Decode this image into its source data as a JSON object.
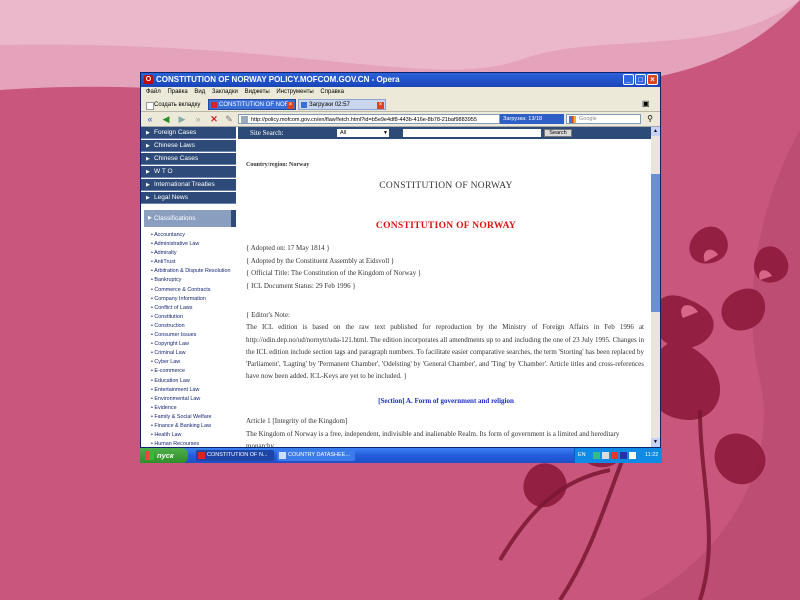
{
  "window": {
    "title": "CONSTITUTION OF NORWAY POLICY.MOFCOM.GOV.CN - Opera",
    "menu": [
      "Файл",
      "Правка",
      "Вид",
      "Закладки",
      "Виджеты",
      "Инструменты",
      "Справка"
    ]
  },
  "tabs": [
    {
      "label": "Создать вкладку",
      "active": false
    },
    {
      "label": "CONSTITUTION OF NOR...",
      "active": true
    },
    {
      "label": "Загрузки 02:57",
      "active": false
    }
  ],
  "address": {
    "url": "http://policy.mofcom.gov.cn/en/flaw!fetch.html?id=b5e9e4df8-443b-416e-8b78-21baf9883955",
    "progress": "Загрузка: 13/18",
    "search_placeholder": "Google"
  },
  "sidebar": {
    "nav": [
      "Foreign Cases",
      "Chinese Laws",
      "Chinese Cases",
      "W T O",
      "International Treaties",
      "Legal News"
    ],
    "classifications_title": "Classifications",
    "classifications": [
      "Accountancy",
      "Administrative Law",
      "Admiralty",
      "AntiTrust",
      "Arbitration & Dispute Resolution",
      "Bankruptcy",
      "Commerce & Contracts",
      "Company Information",
      "Conflict of Laws",
      "Constitution",
      "Construction",
      "Consumer Issues",
      "Copyright Law",
      "Criminal Law",
      "Cyber Law",
      "E-commerce",
      "Education Law",
      "Entertainment Law",
      "Environmental Law",
      "Evidence",
      "Family & Social Welfare",
      "Finance & Banking Law",
      "Health Law",
      "Human Recourses"
    ]
  },
  "site_search": {
    "label": "Site Search:",
    "select_value": "All",
    "button": "Search"
  },
  "document": {
    "country": "Country/region: Norway",
    "title": "CONSTITUTION OF NORWAY",
    "title_red": "CONSTITUTION OF NORWAY",
    "meta": [
      "{ Adopted on: 17 May 1814 }",
      "{ Adopted by the Constituent Assembly at Eidsvoll }",
      "{ Official Title: The Constitution of the Kingdom of Norway }",
      "{ ICL Document Status: 29 Feb 1996 }"
    ],
    "editors_note": "{ Editor's Note:\nThe ICL edition is based on the raw text published for reproduction by the Ministry of Foreign Affairs in Feb 1996 at http://odin.dep.no/ud/nornytt/uda-121.html. The edition incorporates all amendments up to and including the one of 23 July 1995. Changes in the ICL edition include section tags and paragraph numbers. To facilitate easier comparative searches, the term 'Storting' has been replaced by 'Parliament', 'Lagting' by 'Permanent Chamber', 'Odelsting' by 'General Chamber', and 'Ting' by 'Chamber'. Article titles and cross-references have now been added. ICL-Keys are yet to be included. }",
    "section": "[Section] A. Form of government and religion",
    "article_title": "Article 1 [Integrity of the Kingdom]",
    "article_text": "The Kingdom of Norway is a free, independent, indivisible and inalienable Realm. Its form of government is a limited and hereditary monarchy."
  },
  "taskbar": {
    "start": "пуск",
    "tasks": [
      "CONSTITUTION OF N...",
      "COUNTRY DATASHEE..."
    ],
    "lang": "EN",
    "clock": "11:22"
  },
  "colors": {
    "wallpaper": "#c9577d",
    "nav_blue": "#2e4a78",
    "red_title": "#dd1111",
    "section_blue": "#1b2ec5"
  }
}
